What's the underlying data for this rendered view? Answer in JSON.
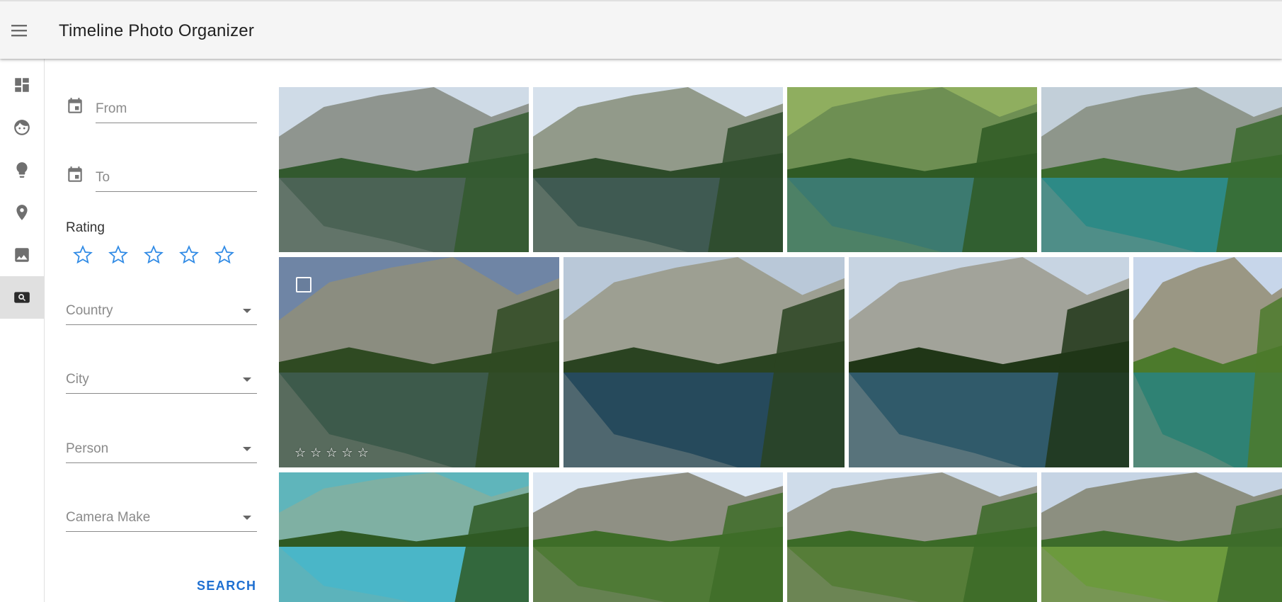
{
  "app": {
    "title": "Timeline Photo Organizer"
  },
  "rail": {
    "items": [
      {
        "name": "dashboard",
        "icon": "dashboard-icon"
      },
      {
        "name": "faces",
        "icon": "face-icon"
      },
      {
        "name": "ideas",
        "icon": "lightbulb-icon"
      },
      {
        "name": "places",
        "icon": "place-icon"
      },
      {
        "name": "photos",
        "icon": "image-icon"
      },
      {
        "name": "search",
        "icon": "image-search-icon",
        "active": true
      }
    ]
  },
  "filters": {
    "from_placeholder": "From",
    "to_placeholder": "To",
    "rating_label": "Rating",
    "rating_value": 0,
    "rating_max": 5,
    "country_placeholder": "Country",
    "city_placeholder": "City",
    "person_placeholder": "Person",
    "camera_make_placeholder": "Camera Make",
    "search_label": "SEARCH"
  },
  "gallery": {
    "rows": [
      {
        "photos": [
          {
            "sky": "#cfdbe7",
            "rock": "#8f958f",
            "forest": "#32592e",
            "water": "#4b6355"
          },
          {
            "sky": "#d6e1ec",
            "rock": "#929a8a",
            "forest": "#2d4b29",
            "water": "#3f5a52"
          },
          {
            "sky": "#8fae5f",
            "rock": "#6e8f53",
            "forest": "#2f5a24",
            "water": "#3c7a70"
          },
          {
            "sky": "#c2cfd9",
            "rock": "#8e968b",
            "forest": "#3a6a2c",
            "water": "#2d8a86"
          }
        ]
      },
      {
        "photos": [
          {
            "sky": "#6f85a5",
            "rock": "#8b8d80",
            "forest": "#2f4a22",
            "water": "#3d5a4b",
            "hover": true,
            "stars": 5
          },
          {
            "sky": "#b9c8d8",
            "rock": "#9d9f92",
            "forest": "#2a4321",
            "water": "#264a5c"
          },
          {
            "sky": "#c7d4e2",
            "rock": "#a2a39a",
            "forest": "#203617",
            "water": "#305a6a"
          },
          {
            "sky": "#c7d6ea",
            "rock": "#9a9784",
            "forest": "#4c7a2c",
            "water": "#2f8274"
          }
        ]
      },
      {
        "photos": [
          {
            "sky": "#5fb5bb",
            "rock": "#7fb0a3",
            "forest": "#2f5a24",
            "water": "#4ab6c8"
          },
          {
            "sky": "#dbe6f2",
            "rock": "#8f9084",
            "forest": "#3e6d28",
            "water": "#4f7a36"
          },
          {
            "sky": "#cfdcea",
            "rock": "#94968a",
            "forest": "#3b6a27",
            "water": "#567d38"
          },
          {
            "sky": "#c6d4e4",
            "rock": "#8c8f80",
            "forest": "#3d6c2a",
            "water": "#6c9a3d"
          }
        ]
      }
    ]
  }
}
